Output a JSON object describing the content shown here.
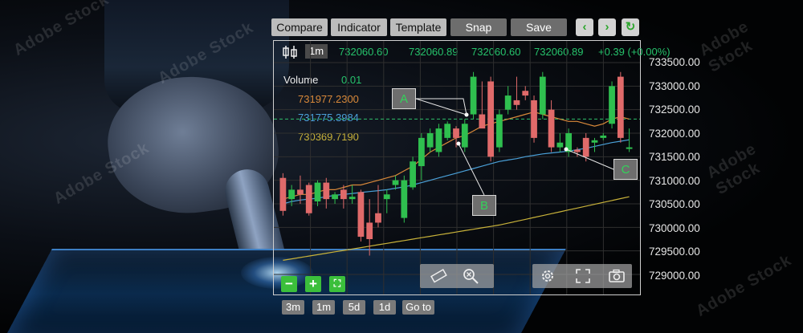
{
  "toolbar": {
    "compare": "Compare",
    "indicator": "Indicator",
    "template": "Template",
    "snap": "Snap",
    "save": "Save",
    "back_icon": "chevron-left-icon",
    "forward_icon": "chevron-right-icon",
    "refresh_icon": "refresh-icon"
  },
  "header": {
    "interval": "1m",
    "open": "732060.60",
    "high": "732060.89",
    "low": "732060.60",
    "close": "732060.89",
    "change": "+0.39 (+0.00%)"
  },
  "legend": {
    "volume_label": "Volume",
    "volume_value": "0.01",
    "ma1": "731977.2300",
    "ma2": "731775.3984",
    "ma3": "730369.7190"
  },
  "markers": {
    "a": "A",
    "b": "B",
    "c": "C"
  },
  "price_axis": [
    "733500.00",
    "733000.00",
    "732500.00",
    "732000.00",
    "731500.00",
    "731000.00",
    "730500.00",
    "730000.00",
    "729500.00",
    "729000.00"
  ],
  "periods": [
    "3m",
    "1m",
    "5d",
    "1d",
    "Go to"
  ],
  "watermark": "Adobe Stock",
  "colors": {
    "up": "#2fbf4f",
    "down": "#e06a6a",
    "ma1": "#d9893a",
    "ma2": "#4aa0d8",
    "ma3": "#c8b23a",
    "accent": "#2da62d"
  },
  "chart_data": {
    "type": "candlestick",
    "ylim": [
      729000,
      733500
    ],
    "candles": [
      {
        "o": 731050,
        "h": 731150,
        "l": 730250,
        "c": 730350
      },
      {
        "o": 730600,
        "h": 730900,
        "l": 730450,
        "c": 730800
      },
      {
        "o": 730800,
        "h": 731100,
        "l": 730500,
        "c": 730700
      },
      {
        "o": 730900,
        "h": 730950,
        "l": 730250,
        "c": 730300
      },
      {
        "o": 730550,
        "h": 731000,
        "l": 730450,
        "c": 730950
      },
      {
        "o": 730950,
        "h": 731050,
        "l": 730400,
        "c": 730600
      },
      {
        "o": 730600,
        "h": 730750,
        "l": 730500,
        "c": 730700
      },
      {
        "o": 730800,
        "h": 730900,
        "l": 730400,
        "c": 730600
      },
      {
        "o": 730600,
        "h": 730900,
        "l": 730500,
        "c": 730650
      },
      {
        "o": 730750,
        "h": 730800,
        "l": 729700,
        "c": 729800
      },
      {
        "o": 730100,
        "h": 730600,
        "l": 729400,
        "c": 729750
      },
      {
        "o": 730300,
        "h": 730900,
        "l": 730000,
        "c": 730100
      },
      {
        "o": 730600,
        "h": 730800,
        "l": 730300,
        "c": 730700
      },
      {
        "o": 730900,
        "h": 731100,
        "l": 730800,
        "c": 731000
      },
      {
        "o": 730200,
        "h": 731100,
        "l": 730100,
        "c": 731000
      },
      {
        "o": 730850,
        "h": 731500,
        "l": 730800,
        "c": 731400
      },
      {
        "o": 731300,
        "h": 732000,
        "l": 731000,
        "c": 731900
      },
      {
        "o": 731700,
        "h": 732100,
        "l": 731600,
        "c": 732000
      },
      {
        "o": 731600,
        "h": 732200,
        "l": 731500,
        "c": 732100
      },
      {
        "o": 731900,
        "h": 732250,
        "l": 731850,
        "c": 732200
      },
      {
        "o": 732100,
        "h": 732150,
        "l": 731700,
        "c": 731900
      },
      {
        "o": 731700,
        "h": 732300,
        "l": 731600,
        "c": 732200
      },
      {
        "o": 732400,
        "h": 733300,
        "l": 732300,
        "c": 733200
      },
      {
        "o": 732400,
        "h": 733100,
        "l": 732200,
        "c": 732100
      },
      {
        "o": 733100,
        "h": 733200,
        "l": 731400,
        "c": 731500
      },
      {
        "o": 731700,
        "h": 732500,
        "l": 731600,
        "c": 732400
      },
      {
        "o": 732500,
        "h": 733000,
        "l": 732400,
        "c": 732800
      },
      {
        "o": 732700,
        "h": 733200,
        "l": 732500,
        "c": 732600
      },
      {
        "o": 732900,
        "h": 733000,
        "l": 732700,
        "c": 732800
      },
      {
        "o": 732700,
        "h": 732800,
        "l": 731800,
        "c": 731900
      },
      {
        "o": 732400,
        "h": 733300,
        "l": 732300,
        "c": 733200
      },
      {
        "o": 732500,
        "h": 732700,
        "l": 731600,
        "c": 731700
      },
      {
        "o": 731700,
        "h": 732000,
        "l": 731600,
        "c": 731800
      },
      {
        "o": 731600,
        "h": 732100,
        "l": 731500,
        "c": 732000
      },
      {
        "o": 731650,
        "h": 731700,
        "l": 731500,
        "c": 731600
      },
      {
        "o": 731900,
        "h": 732000,
        "l": 731400,
        "c": 731500
      },
      {
        "o": 731800,
        "h": 731900,
        "l": 731600,
        "c": 731850
      },
      {
        "o": 731900,
        "h": 732000,
        "l": 731850,
        "c": 731950
      },
      {
        "o": 732200,
        "h": 733100,
        "l": 732100,
        "c": 733000
      },
      {
        "o": 733200,
        "h": 733300,
        "l": 731800,
        "c": 731900
      },
      {
        "o": 731700,
        "h": 732100,
        "l": 731600,
        "c": 731700
      }
    ],
    "ma1": [
      730600,
      730650,
      730700,
      730700,
      730750,
      730800,
      730800,
      730850,
      730900,
      730900,
      730950,
      731000,
      731050,
      731100,
      731200,
      731300,
      731450,
      731600,
      731700,
      731800,
      731900,
      731950,
      732050,
      732150,
      732200,
      732250,
      732300,
      732350,
      732400,
      732450,
      732400,
      732350,
      732300,
      732250,
      732250,
      732200,
      732150,
      732200,
      732300,
      732350,
      732300
    ],
    "ma2": [
      730500,
      730550,
      730580,
      730600,
      730620,
      730650,
      730680,
      730700,
      730720,
      730740,
      730760,
      730780,
      730800,
      730830,
      730860,
      730900,
      730950,
      731000,
      731050,
      731100,
      731150,
      731200,
      731250,
      731300,
      731350,
      731400,
      731430,
      731460,
      731500,
      731530,
      731560,
      731580,
      731600,
      731620,
      731650,
      731680,
      731720,
      731760,
      731800,
      731830,
      731860
    ],
    "ma3": [
      729300,
      729330,
      729360,
      729390,
      729420,
      729450,
      729480,
      729510,
      729540,
      729570,
      729600,
      729630,
      729660,
      729690,
      729720,
      729750,
      729780,
      729810,
      729840,
      729870,
      729900,
      729930,
      729960,
      729990,
      730020,
      730050,
      730090,
      730130,
      730170,
      730210,
      730250,
      730290,
      730330,
      730370,
      730410,
      730450,
      730490,
      730530,
      730570,
      730610,
      730650
    ],
    "dashed_level": 732300
  }
}
